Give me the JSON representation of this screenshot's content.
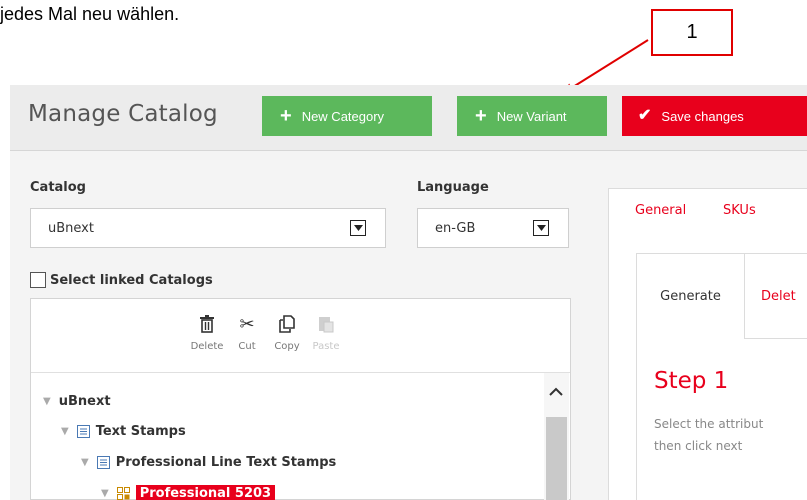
{
  "document": {
    "text": "jedes Mal neu wählen.",
    "callout_number": "1"
  },
  "app": {
    "title": "Manage Catalog",
    "buttons": {
      "new_category": "New Category",
      "new_variant": "New Variant",
      "save_changes": "Save changes"
    },
    "catalog": {
      "label": "Catalog",
      "value": "uBnext"
    },
    "language": {
      "label": "Language",
      "value": "en-GB"
    },
    "select_linked": {
      "label": "Select linked Catalogs",
      "checked": false
    },
    "toolbar": {
      "delete": "Delete",
      "cut": "Cut",
      "copy": "Copy",
      "paste": "Paste"
    },
    "tree": {
      "root": "uBnext",
      "level1": "Text Stamps",
      "level2": "Professional Line Text Stamps",
      "level3": "Professional 5203"
    },
    "right_tabs": {
      "general": "General",
      "skus": "SKUs"
    },
    "subtabs": {
      "generate": "Generate",
      "delete": "Delet"
    },
    "step": {
      "title": "Step 1",
      "line1": "Select the attribut",
      "line2": "then click next"
    }
  },
  "colors": {
    "green": "#5cb85c",
    "red": "#e8001c",
    "annotation_red": "#e00000"
  },
  "icons": {
    "new_category": "plus-icon",
    "new_variant": "plus-icon",
    "save": "check-icon",
    "delete": "trash-icon",
    "cut": "scissors-icon",
    "copy": "copy-icon",
    "paste": "paste-icon"
  }
}
